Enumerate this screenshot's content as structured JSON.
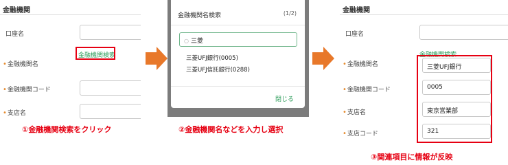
{
  "step1": {
    "section_title": "金融機関",
    "account_name_label": "口座名",
    "bank_name_label": "金融機関名",
    "bank_search_link": "金融機関検索",
    "bank_code_label": "金融機関コード",
    "branch_name_label": "支店名",
    "required_mark": "•",
    "caption": "①金融機関検索をクリック"
  },
  "step2": {
    "dialog_title": "金融機関名検索",
    "page_indicator": "(1/2)",
    "search_value": "三菱",
    "results": [
      "三菱UFJ銀行(0005)",
      "三菱UFJ信託銀行(0288)"
    ],
    "close_label": "閉じる",
    "caption": "②金融機関名などを入力し選択"
  },
  "step3": {
    "section_title": "金融機関",
    "account_name_label": "口座名",
    "bank_search_link": "金融機関検索",
    "bank_name_label": "金融機関名",
    "bank_name_value": "三菱UFJ銀行",
    "bank_code_label": "金融機関コード",
    "bank_code_value": "0005",
    "branch_name_label": "支店名",
    "branch_name_value": "東京営業部",
    "branch_code_label": "支店コード",
    "branch_code_value": "321",
    "required_mark": "•",
    "caption": "③関連項目に情報が反映"
  },
  "colors": {
    "highlight": "#e60012",
    "arrow": "#e8782a",
    "link_green": "#2e9d5b",
    "overlay": "#7c7c7c"
  }
}
